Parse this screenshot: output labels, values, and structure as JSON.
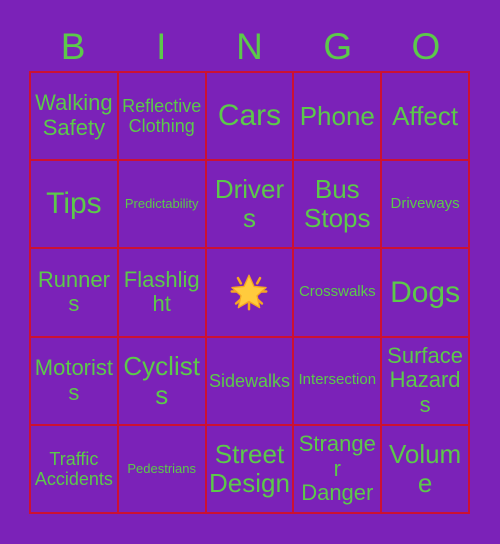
{
  "card": {
    "title_letters": [
      "B",
      "I",
      "N",
      "G",
      "O"
    ],
    "colors": {
      "background": "#7B22B8",
      "text": "#5CC94A",
      "border": "#CC1133",
      "free_star": "#FFC83D"
    },
    "rows": [
      [
        {
          "label": "Walking Safety",
          "size": "md"
        },
        {
          "label": "Reflective Clothing",
          "size": "sm"
        },
        {
          "label": "Cars",
          "size": "xl"
        },
        {
          "label": "Phone",
          "size": "lg"
        },
        {
          "label": "Affect",
          "size": "lg"
        }
      ],
      [
        {
          "label": "Tips",
          "size": "xl"
        },
        {
          "label": "Predictability",
          "size": "xxs"
        },
        {
          "label": "Drivers",
          "size": "lg"
        },
        {
          "label": "Bus Stops",
          "size": "lg"
        },
        {
          "label": "Driveways",
          "size": "xs"
        }
      ],
      [
        {
          "label": "Runners",
          "size": "md"
        },
        {
          "label": "Flashlight",
          "size": "md"
        },
        {
          "label": "",
          "size": "md",
          "icon": "glowing-star-icon"
        },
        {
          "label": "Crosswalks",
          "size": "xs"
        },
        {
          "label": "Dogs",
          "size": "xl"
        }
      ],
      [
        {
          "label": "Motorists",
          "size": "md"
        },
        {
          "label": "Cyclists",
          "size": "lg"
        },
        {
          "label": "Sidewalks",
          "size": "sm"
        },
        {
          "label": "Intersection",
          "size": "xs"
        },
        {
          "label": "Surface Hazards",
          "size": "md"
        }
      ],
      [
        {
          "label": "Traffic Accidents",
          "size": "sm"
        },
        {
          "label": "Pedestrians",
          "size": "xxs"
        },
        {
          "label": "Street Design",
          "size": "lg"
        },
        {
          "label": "Stranger Danger",
          "size": "md"
        },
        {
          "label": "Volume",
          "size": "lg"
        }
      ]
    ]
  }
}
